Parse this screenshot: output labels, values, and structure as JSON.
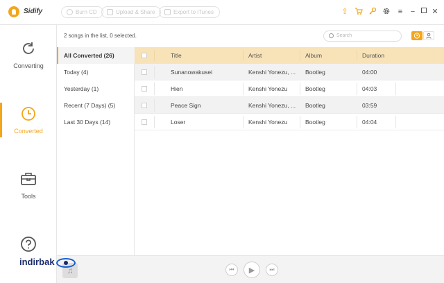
{
  "app": {
    "name": "Sidify",
    "accent_color": "#f3a61c"
  },
  "toolbar": {
    "burn_cd": "Burn CD",
    "upload_share": "Upload & Share",
    "export_itunes": "Export to iTunes",
    "icons": [
      "upgrade-arrow-icon",
      "cart-icon",
      "key-icon",
      "gear-icon",
      "menu-icon",
      "minimize-icon",
      "maximize-icon",
      "close-icon"
    ]
  },
  "sidebar": {
    "items": [
      {
        "label": "Converting",
        "icon": "refresh-icon"
      },
      {
        "label": "Converted",
        "icon": "clock-icon",
        "active": true
      },
      {
        "label": "Tools",
        "icon": "toolbox-icon"
      },
      {
        "label": "",
        "icon": "help-icon"
      }
    ]
  },
  "info": {
    "count_text": "2 songs in the list, 0 selected.",
    "search_placeholder": "Search"
  },
  "filters": [
    {
      "label": "All Converted (26)",
      "active": true
    },
    {
      "label": "Today (4)"
    },
    {
      "label": "Yesterday (1)"
    },
    {
      "label": "Recent (7 Days) (5)"
    },
    {
      "label": "Last 30 Days (14)"
    }
  ],
  "table": {
    "columns": [
      "Title",
      "Artist",
      "Album",
      "Duration"
    ],
    "rows": [
      {
        "title": "Sunanowakusei",
        "artist": "Kenshi Yonezu, ...",
        "album": "Bootleg",
        "duration": "04:00"
      },
      {
        "title": "Hien",
        "artist": "Kenshi Yonezu",
        "album": "Bootleg",
        "duration": "04:03"
      },
      {
        "title": "Peace Sign",
        "artist": "Kenshi Yonezu, ...",
        "album": "Bootleg",
        "duration": "03:59"
      },
      {
        "title": "Loser",
        "artist": "Kenshi Yonezu",
        "album": "Bootleg",
        "duration": "04:04"
      }
    ]
  },
  "watermark": "indirbak"
}
